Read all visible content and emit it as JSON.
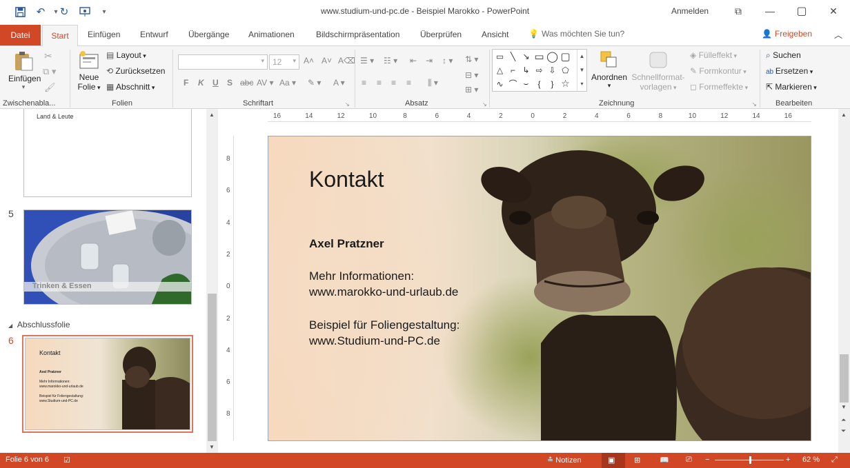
{
  "window": {
    "title": "www.studium-und-pc.de - Beispiel Marokko  -  PowerPoint",
    "signin": "Anmelden",
    "min_glyph": "—",
    "restore_glyph": "▢",
    "close_glyph": "✕",
    "ribbon_options_glyph": "⧉"
  },
  "tabs": {
    "file": "Datei",
    "home": "Start",
    "items": [
      "Einfügen",
      "Entwurf",
      "Übergänge",
      "Animationen",
      "Bildschirmpräsentation",
      "Überprüfen",
      "Ansicht"
    ],
    "tellme": "Was möchten Sie tun?",
    "share": "Freigeben"
  },
  "ribbon": {
    "clipboard": {
      "label": "Zwischenabla...",
      "paste": "Einfügen"
    },
    "slides": {
      "label": "Folien",
      "new_slide_1": "Neue",
      "new_slide_2": "Folie",
      "layout": "Layout",
      "reset": "Zurücksetzen",
      "section": "Abschnitt"
    },
    "font": {
      "label": "Schriftart",
      "size": "12",
      "bold": "F",
      "italic": "K",
      "underline": "U",
      "shadow": "S",
      "strike": "abc"
    },
    "paragraph": {
      "label": "Absatz"
    },
    "drawing": {
      "label": "Zeichnung",
      "arrange": "Anordnen",
      "quickstyles_1": "Schnellformat-",
      "quickstyles_2": "vorlagen",
      "fill": "Fülleffekt",
      "outline": "Formkontur",
      "effects": "Formeffekte"
    },
    "editing": {
      "label": "Bearbeiten",
      "find": "Suchen",
      "replace": "Ersetzen",
      "select": "Markieren"
    }
  },
  "thumbnails": {
    "slide4_text": "Land & Leute",
    "slide5_num": "5",
    "slide5_caption": "Trinken & Essen",
    "section_name": "Abschlussfolie",
    "slide6_num": "6"
  },
  "ruler": {
    "h_ticks": [
      "16",
      "14",
      "12",
      "10",
      "8",
      "6",
      "4",
      "2",
      "0",
      "2",
      "4",
      "6",
      "8",
      "10",
      "12",
      "14",
      "16"
    ],
    "v_ticks": [
      "8",
      "6",
      "4",
      "2",
      "0",
      "2",
      "4",
      "6",
      "8"
    ]
  },
  "slide": {
    "title": "Kontakt",
    "name": "Axel Pratzner",
    "info_label": "Mehr Informationen:",
    "info_url": "www.marokko-und-urlaub.de",
    "example_label": "Beispiel für Foliengestaltung:",
    "example_url": "www.Studium-und-PC.de"
  },
  "status": {
    "slide_info": "Folie 6 von 6",
    "notes": "Notizen",
    "zoom": "62 %",
    "zoom_level": 0.52
  },
  "colors": {
    "accent": "#d24726",
    "ribbon_bg": "#f5f5f5"
  }
}
